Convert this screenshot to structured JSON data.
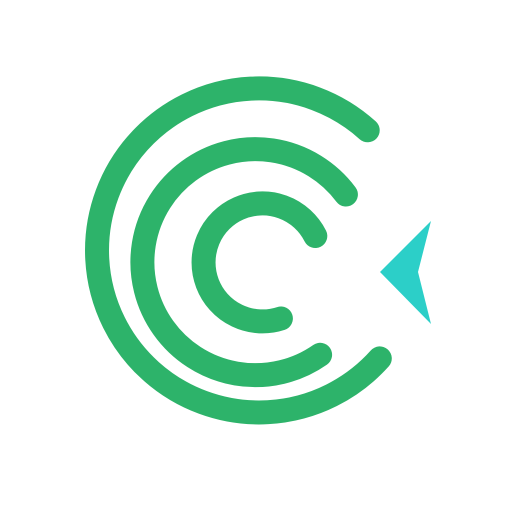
{
  "logo": {
    "icon": "concentric-c-arrow-logo-icon",
    "arc_count": 3,
    "colors": {
      "background": "#ffffff",
      "arcs": "#2db36a",
      "arrow": "#2ccfc8"
    }
  }
}
